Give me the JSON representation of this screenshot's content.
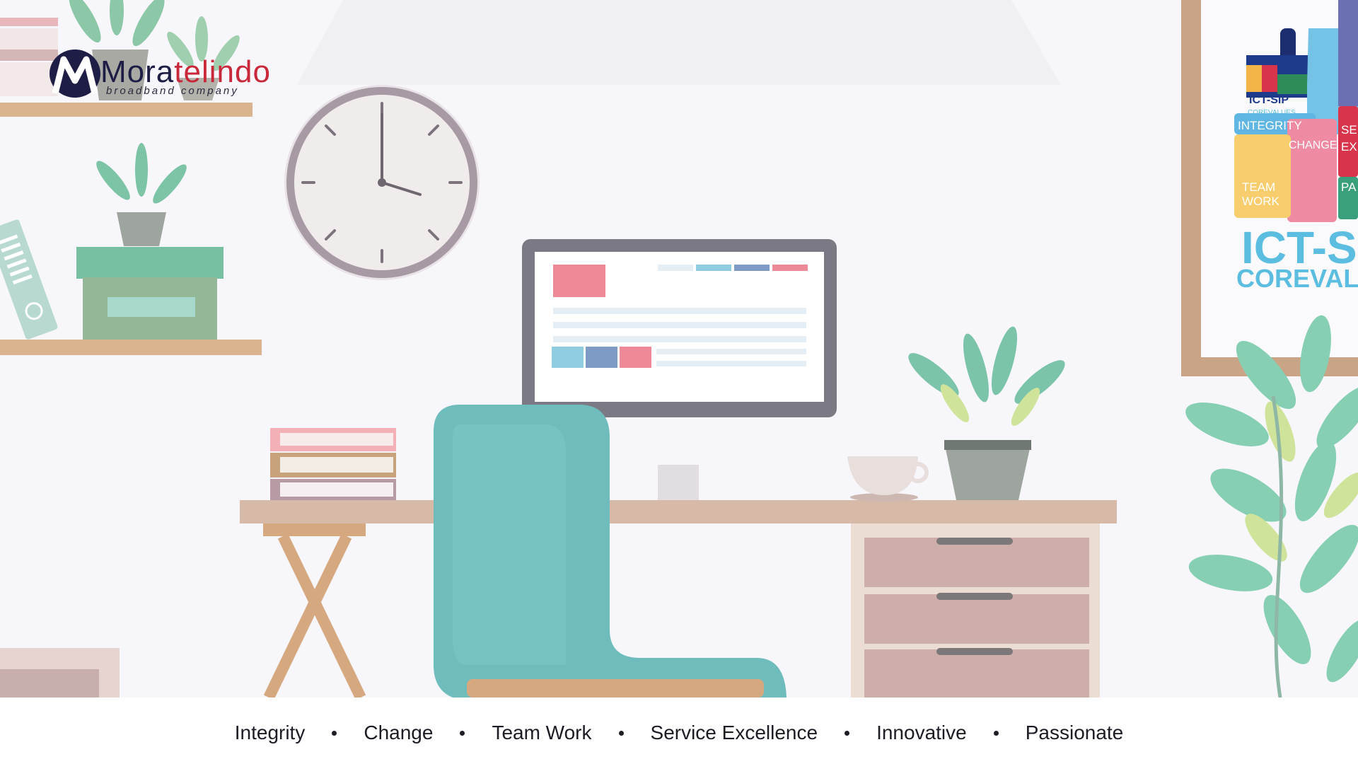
{
  "logo": {
    "name_part1": "Mora",
    "name_part2": "telindo",
    "tagline": "broadband company"
  },
  "poster": {
    "title_small": "ICT-SIP",
    "subtitle_small": "COREVALUES",
    "piece_integrity": "INTEGRITY",
    "piece_change": "CHANGE",
    "piece_team": "TEAM",
    "piece_work": "WORK",
    "piece_se": "SE",
    "piece_ex": "EX",
    "piece_pa": "PA",
    "title_big": "ICT-S",
    "subtitle_big": "COREVAL"
  },
  "footer": {
    "values": [
      "Integrity",
      "Change",
      "Team Work",
      "Service Excellence",
      "Innovative",
      "Passionate"
    ]
  },
  "colors": {
    "background": "#f7f7fb",
    "teal": "#6fbcbc",
    "pink": "#ee8a97",
    "wood": "#d5b596",
    "brand_red": "#c8283a",
    "brand_navy": "#1d1d45"
  }
}
